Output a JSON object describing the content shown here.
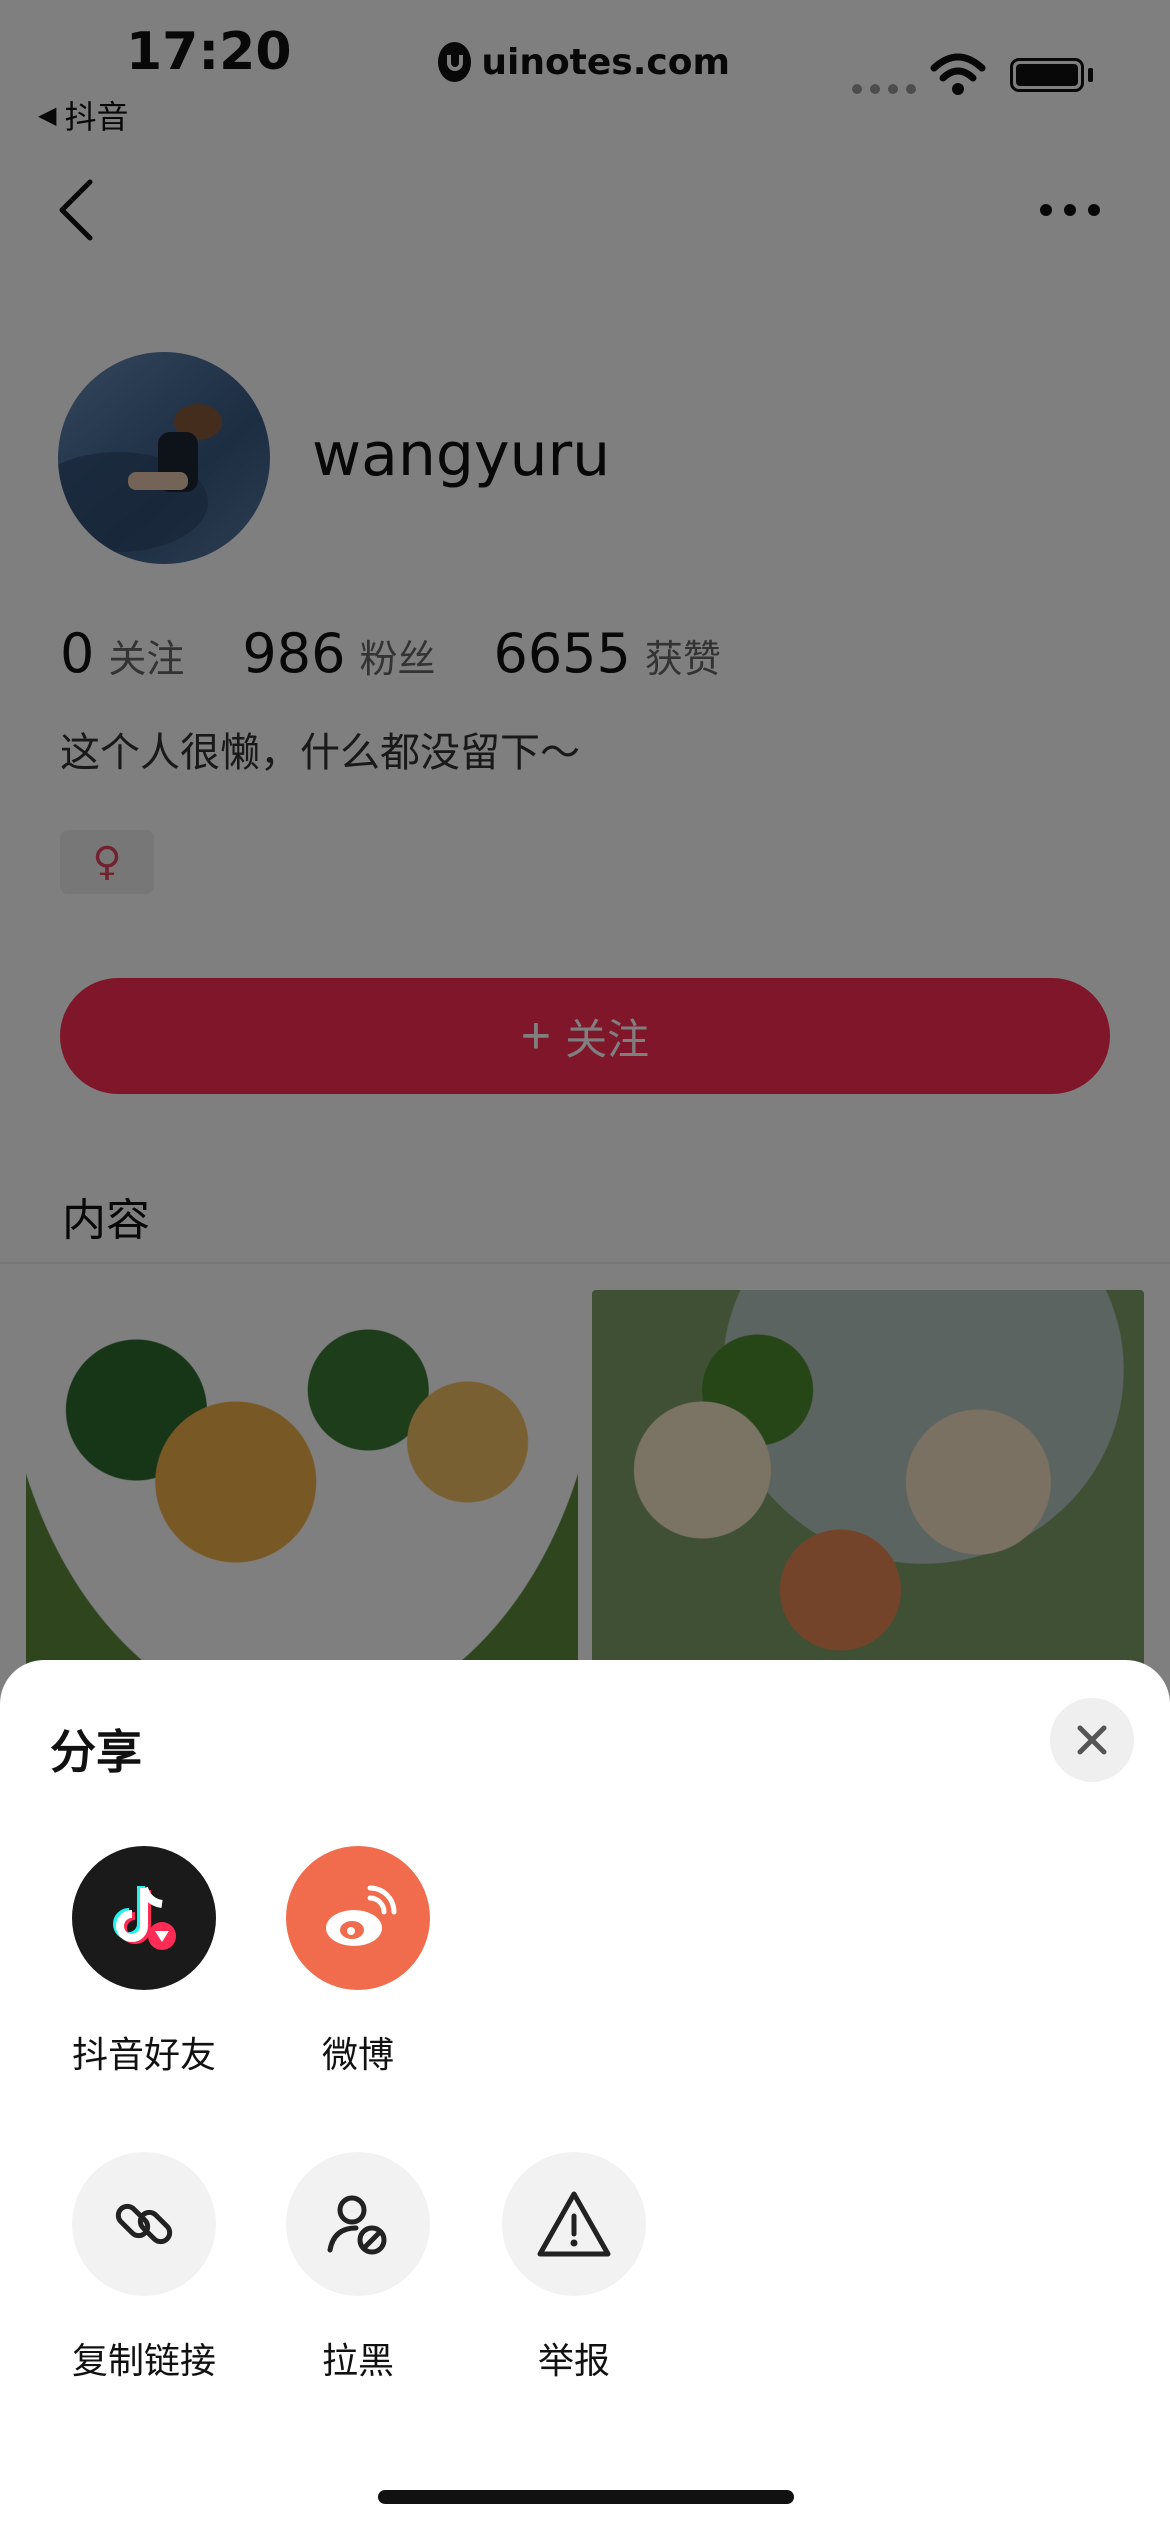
{
  "status_bar": {
    "time": "17:20",
    "back_app": "抖音",
    "watermark": "uinotes.com"
  },
  "profile": {
    "username": "wangyuru",
    "stats": [
      {
        "value": "0",
        "label": "关注"
      },
      {
        "value": "986",
        "label": "粉丝"
      },
      {
        "value": "6655",
        "label": "获赞"
      }
    ],
    "bio": "这个人很懒，什么都没留下～",
    "gender_symbol": "♀",
    "follow_button": "关注",
    "follow_plus": "+",
    "content_title": "内容"
  },
  "share_sheet": {
    "title": "分享",
    "row1": [
      {
        "label": "抖音好友",
        "icon": "douyin-icon"
      },
      {
        "label": "微博",
        "icon": "weibo-icon"
      }
    ],
    "row2": [
      {
        "label": "复制链接",
        "icon": "link-icon"
      },
      {
        "label": "拉黑",
        "icon": "block-user-icon"
      },
      {
        "label": "举报",
        "icon": "warning-icon"
      }
    ]
  },
  "colors": {
    "accent": "#fe2c55",
    "weibo": "#f06c4c",
    "douyin": "#111111"
  }
}
